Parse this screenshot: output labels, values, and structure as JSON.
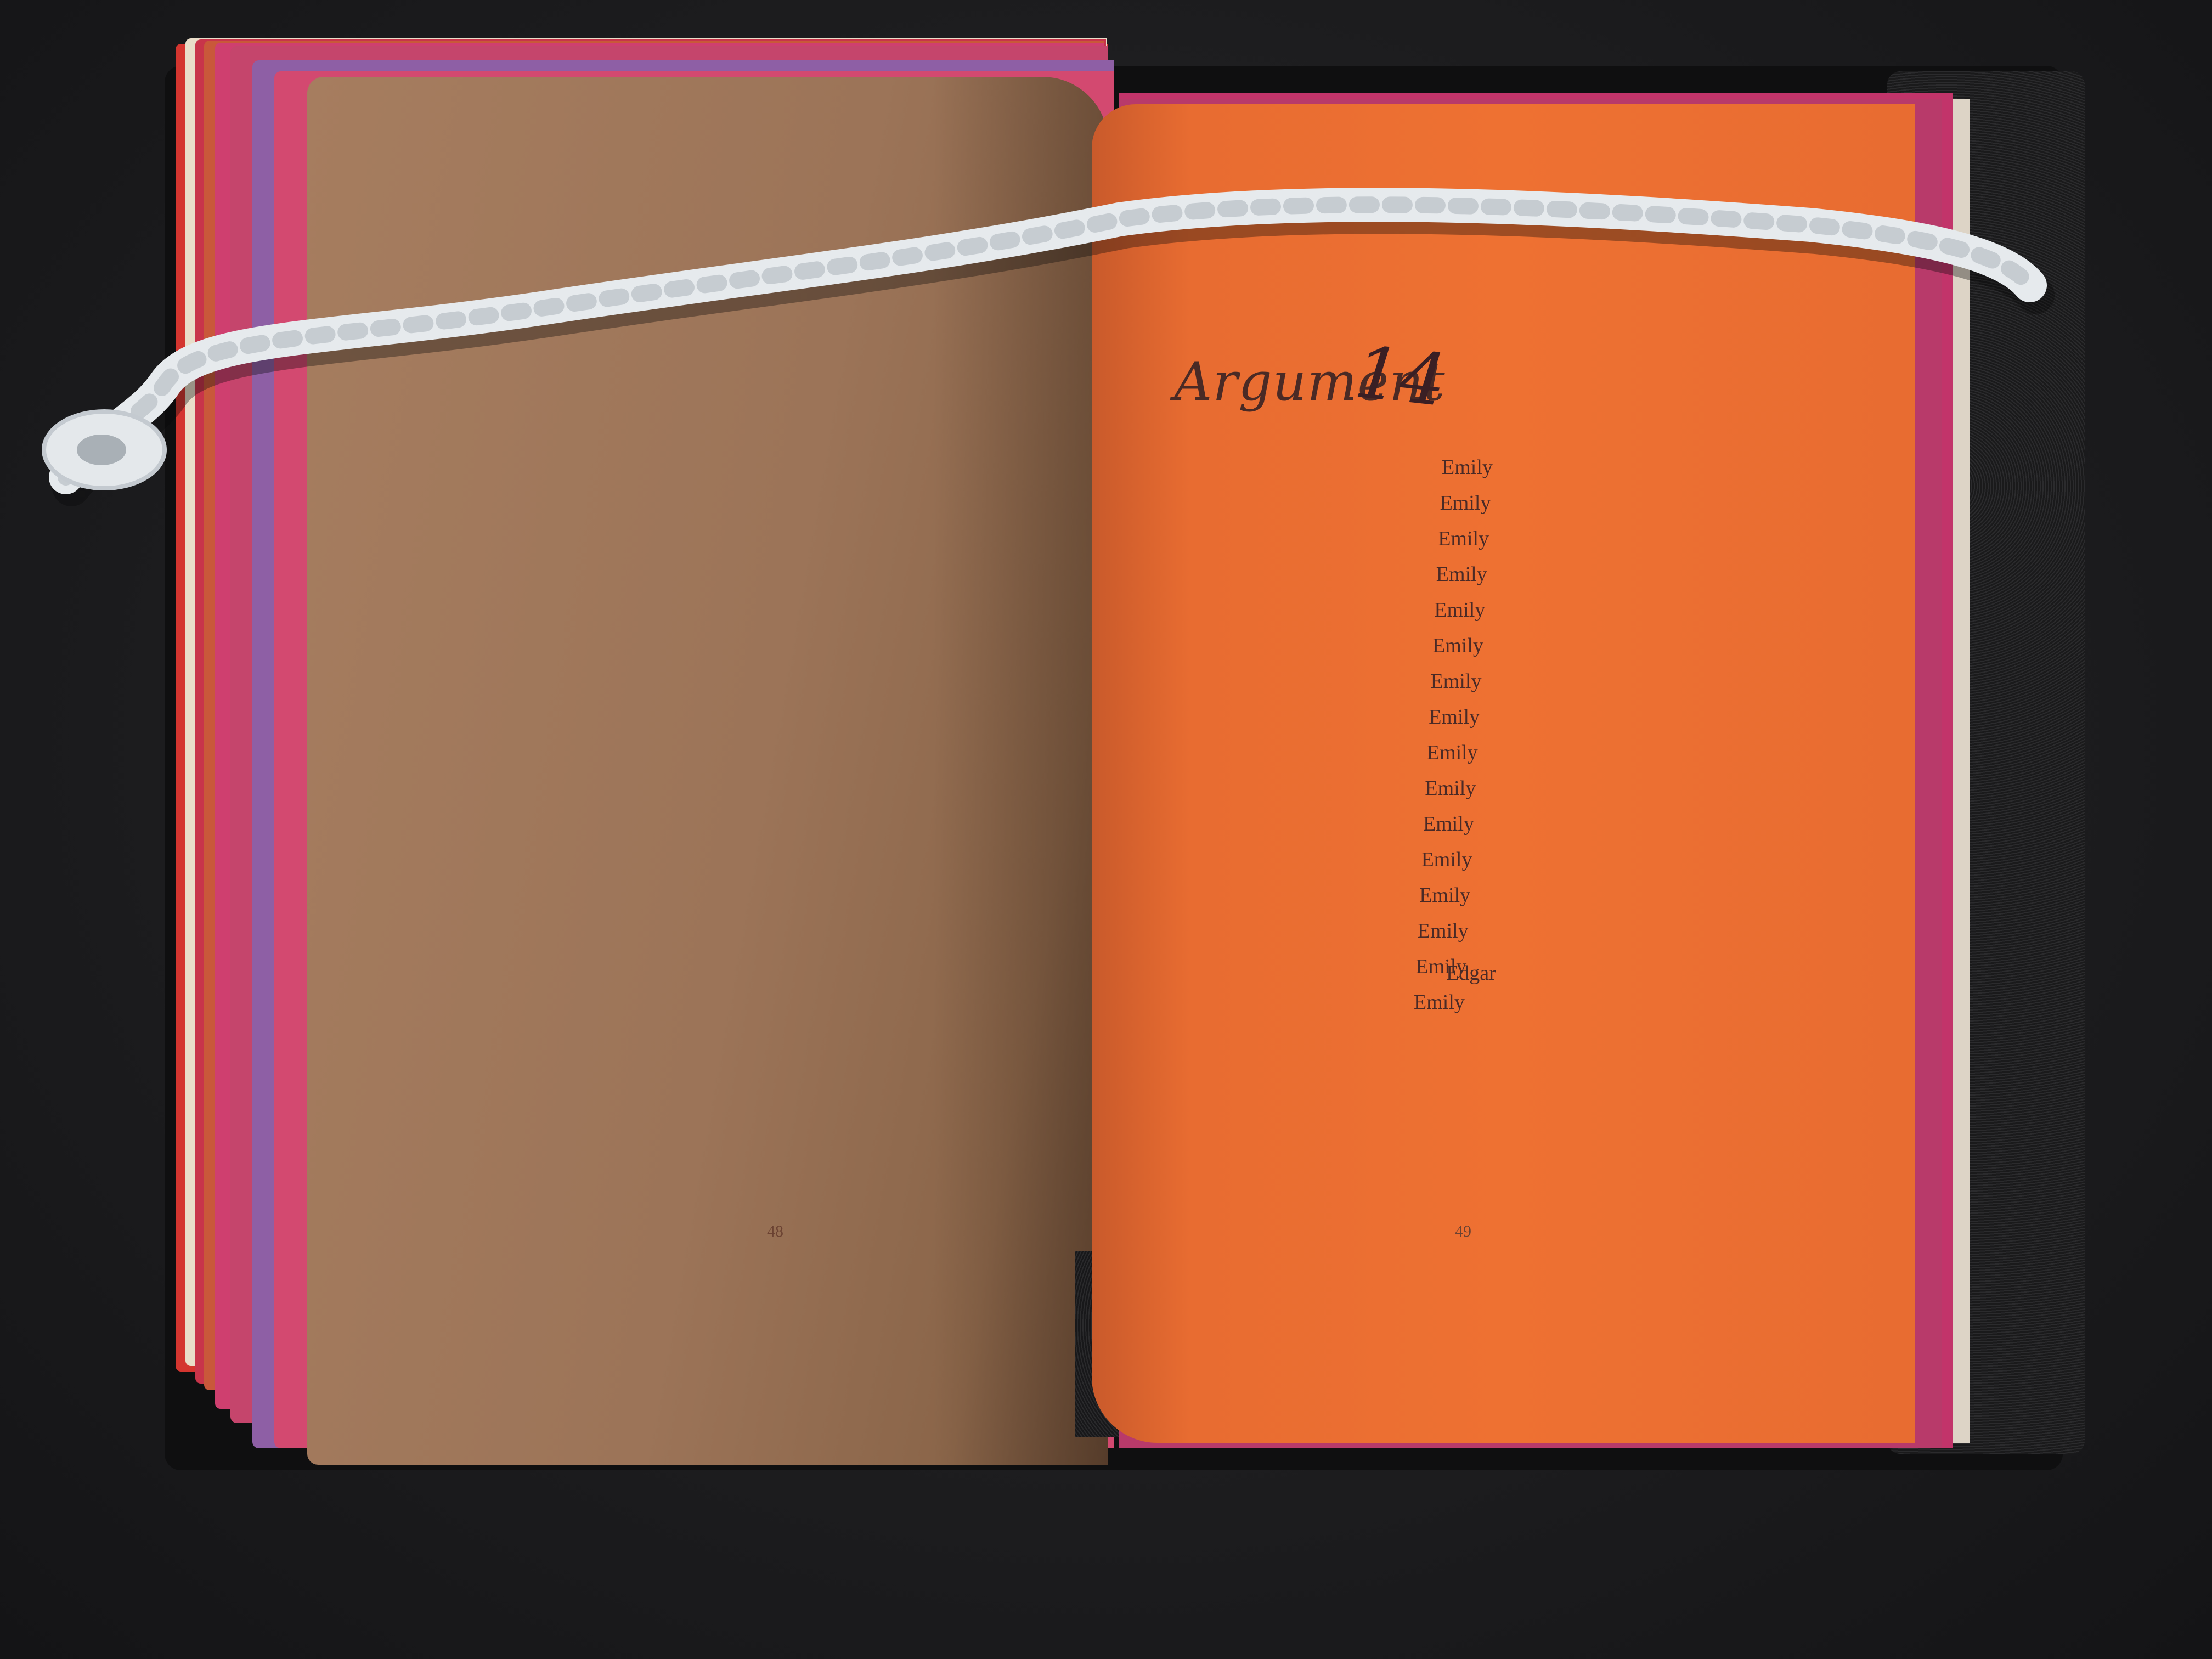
{
  "left_page": {
    "page_number": "48",
    "color": "#9c7458"
  },
  "right_page": {
    "title": "Argument",
    "title_number": "14",
    "color": "#ee7132",
    "page_number": "49",
    "lines": [
      "Emily",
      "Emily",
      "Emily",
      "Emily",
      "Emily",
      "Emily",
      "Emily",
      "Emily",
      "Emily",
      "Emily",
      "Emily",
      "Emily",
      "Emily",
      "Emily",
      "Emily",
      "Emily"
    ],
    "extra_word": "Edgar"
  },
  "cord_color": "#e8ecef",
  "background_color": "#1d1d1f"
}
